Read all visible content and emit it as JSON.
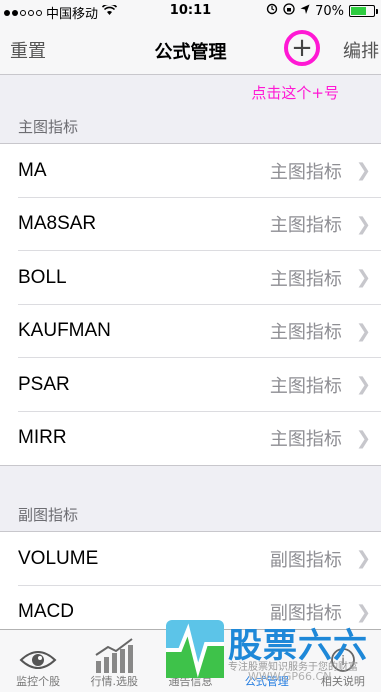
{
  "status_bar": {
    "carrier": "中国移动",
    "time": "10:11",
    "battery": "70%",
    "battery_level": 0.7
  },
  "nav": {
    "reset_label": "重置",
    "title": "公式管理",
    "add_label": "+",
    "edit_label": "编排"
  },
  "hint": "点击这个+号",
  "sections": [
    {
      "header": "主图指标",
      "items": [
        {
          "name": "MA",
          "type": "主图指标"
        },
        {
          "name": "MA8SAR",
          "type": "主图指标"
        },
        {
          "name": "BOLL",
          "type": "主图指标"
        },
        {
          "name": "KAUFMAN",
          "type": "主图指标"
        },
        {
          "name": "PSAR",
          "type": "主图指标"
        },
        {
          "name": "MIRR",
          "type": "主图指标"
        }
      ]
    },
    {
      "header": "副图指标",
      "items": [
        {
          "name": "VOLUME",
          "type": "副图指标"
        },
        {
          "name": "MACD",
          "type": "副图指标"
        }
      ]
    }
  ],
  "tabs": [
    {
      "label": "监控个股",
      "icon": "eye-icon"
    },
    {
      "label": "行情.选股",
      "icon": "bar-chart-icon"
    },
    {
      "label": "通告信息",
      "icon": "bell-icon"
    },
    {
      "label": "公式管理",
      "icon": "formula-icon",
      "active": true
    },
    {
      "label": "相关说明",
      "icon": "info-icon"
    }
  ],
  "watermark": {
    "brand": "股票六六",
    "slogan": "专注股票知识服务于您的财富",
    "url": "WWW.GP66.CN"
  },
  "colors": {
    "highlight": "#ff18d4",
    "accent": "#1f7ae0"
  }
}
